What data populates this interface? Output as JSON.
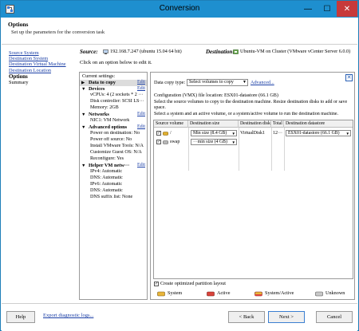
{
  "window": {
    "title": "Conversion",
    "min_glyph": "—",
    "max_glyph": "☐",
    "close_glyph": "✕"
  },
  "header": {
    "title": "Options",
    "subtitle": "Set up the parameters for the conversion task"
  },
  "nav": {
    "items": [
      {
        "label": "Source System",
        "link": true
      },
      {
        "label": "Destination System",
        "link": true
      },
      {
        "label": "Destination Virtual Machine",
        "link": true
      },
      {
        "label": "Destination Location",
        "link": true
      },
      {
        "label": "Options",
        "active": true
      },
      {
        "label": "Summary",
        "link": false
      }
    ]
  },
  "source": {
    "label": "Source:",
    "value": "192.168.7.247 (ubuntu 15.04 64 bit)"
  },
  "destination": {
    "label": "Destination:",
    "value": "Ubuntu-VM on Cluster (VMware vCenter Server 6.0.0)"
  },
  "hint": "Click on an option below to edit it.",
  "current_settings": {
    "heading": "Current settings:",
    "edit_label": "Edit",
    "sections": [
      {
        "title": "Data to copy",
        "selected": true,
        "edit": true,
        "items": []
      },
      {
        "title": "Devices",
        "edit": true,
        "items": [
          "vCPUs: 4 (2 sockets * 2 ···",
          "Disk controller: SCSI LS···",
          "Memory: 2GB"
        ]
      },
      {
        "title": "Networks",
        "edit": true,
        "items": [
          "NIC1: VM Network"
        ]
      },
      {
        "title": "Advanced options",
        "edit": true,
        "items": [
          "Power on destination: No",
          "Power off source: No",
          "Install VMware Tools: N/A",
          "Customize Guest OS: N/A",
          "Reconfigure: Yes"
        ]
      },
      {
        "title": "Helper VM netw···",
        "edit": true,
        "items": [
          "IPv4: Automatic",
          "DNS: Automatic",
          "IPv6: Automatic",
          "DNS: Automatic",
          "DNS suffix list: None"
        ]
      }
    ]
  },
  "panel": {
    "close_glyph": "✕",
    "data_copy_type_label": "Data copy type:",
    "data_copy_type_value": "Select volumes to copy",
    "advanced_link": "Advanced...",
    "config_line": "Configuration (VMX) file location: ESX01-datastore (66.1 GB)",
    "instruction1": "Select the source volumes to copy to the destination machine. Resize destination disks to add or save space.",
    "instruction2": "Select a system and an active volume, or a system/active volume to run the destination machine.",
    "table": {
      "headers": [
        "Source volume",
        "Destination size",
        "Destination disk",
        "Total",
        "Destination datastore"
      ],
      "rows": [
        {
          "checked": true,
          "volume": "/",
          "size": "Min size (8.4 GB)",
          "disk": "VirtualDisk1",
          "total": "12···",
          "datastore": "ESX01-datastore (66.1 GB)",
          "icon_color": "#e0b030"
        },
        {
          "checked": true,
          "volume": "swap",
          "size": "···min size (4 GB)",
          "disk": "",
          "total": "",
          "datastore": "",
          "icon_color": "#b8b8b8"
        }
      ]
    },
    "optimized_label": "Create optimized partition layout",
    "optimized_checked": true,
    "legend": [
      {
        "label": "System",
        "color": "#e9b53a"
      },
      {
        "label": "Active",
        "color": "#d9443c"
      },
      {
        "label": "System/Active",
        "color": "#e9b53a"
      },
      {
        "label": "Unknown",
        "color": "#c8c8c8"
      }
    ]
  },
  "footer": {
    "help": "Help",
    "export": "Export diagnostic logs...",
    "back": "< Back",
    "next": "Next >",
    "cancel": "Cancel"
  }
}
